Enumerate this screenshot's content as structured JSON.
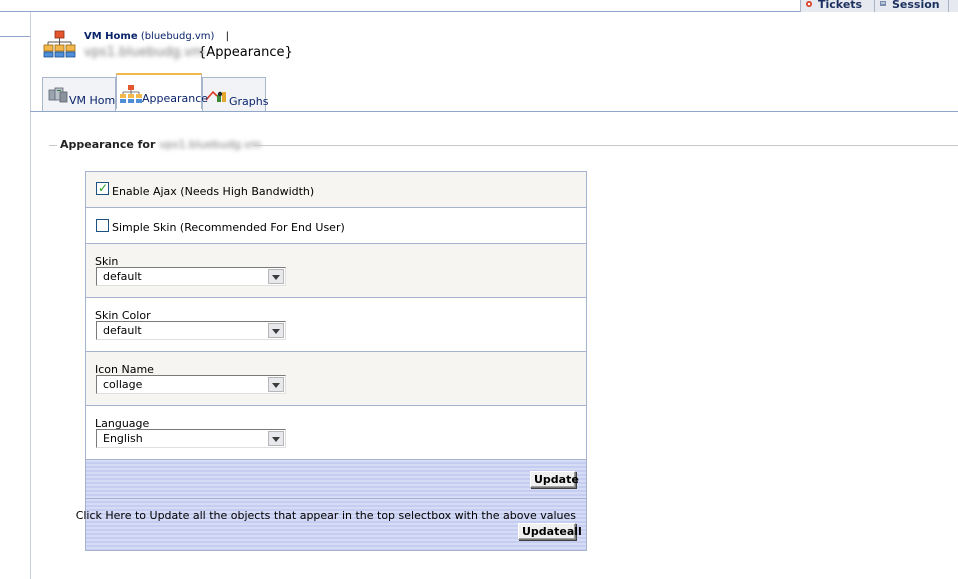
{
  "top_tabs": [
    {
      "label": "Tickets",
      "icon": "tickets-icon"
    },
    {
      "label": "Session",
      "icon": "session-icon"
    }
  ],
  "breadcrumb": {
    "home": "VM Home",
    "sub": "(bluebudg.vm)",
    "separator": "|"
  },
  "page_title": {
    "object": "vps1.bluebudg.vm",
    "suffix": "{Appearance}"
  },
  "tabs": [
    {
      "label": "VM Home",
      "icon": "vm-home-icon",
      "active": false
    },
    {
      "label": "Appearance",
      "icon": "appearance-icon",
      "active": true
    },
    {
      "label": "Graphs",
      "icon": "graphs-icon",
      "active": false
    }
  ],
  "section": {
    "title": "Appearance for",
    "object": "vps1.bluebudg.vm"
  },
  "form": {
    "enable_ajax": {
      "label": "Enable Ajax (Needs High Bandwidth)",
      "checked": true
    },
    "simple_skin": {
      "label": "Simple Skin (Recommended For End User)",
      "checked": false
    },
    "skin": {
      "label": "Skin",
      "value": "default"
    },
    "skin_color": {
      "label": "Skin Color",
      "value": "default"
    },
    "icon_name": {
      "label": "Icon Name",
      "value": "collage"
    },
    "language": {
      "label": "Language",
      "value": "English"
    },
    "update_label": "Update",
    "updateall_hint": "Click Here to Update all the objects that appear in the top selectbox with the above values",
    "updateall_label": "Updateall"
  },
  "colors": {
    "accent": "#0a246a",
    "frame": "#a6b3cf",
    "active_tab": "#f2b84b",
    "band": "#c5cdf0"
  }
}
